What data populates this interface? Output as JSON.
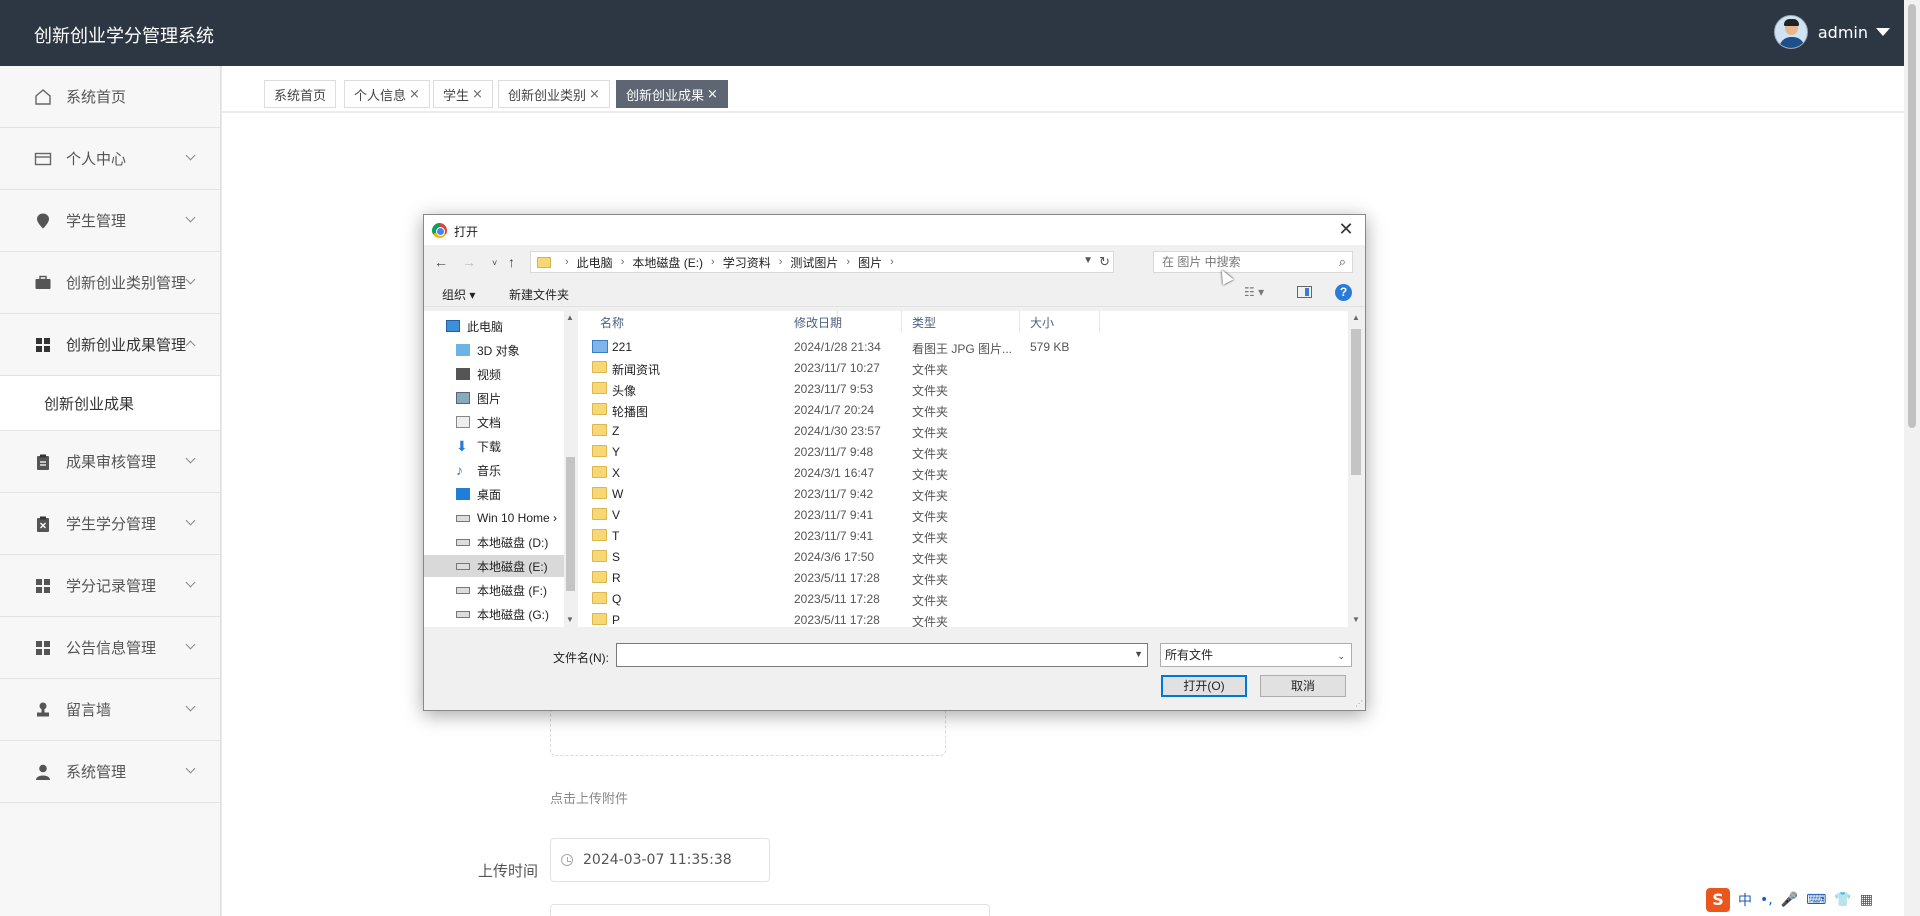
{
  "app": {
    "title": "创新创业学分管理系统",
    "user": "admin"
  },
  "sidebar": {
    "items": [
      {
        "label": "系统首页"
      },
      {
        "label": "个人中心"
      },
      {
        "label": "学生管理"
      },
      {
        "label": "创新创业类别管理"
      },
      {
        "label": "创新创业成果管理"
      },
      {
        "label": "创新创业成果"
      },
      {
        "label": "成果审核管理"
      },
      {
        "label": "学生学分管理"
      },
      {
        "label": "学分记录管理"
      },
      {
        "label": "公告信息管理"
      },
      {
        "label": "留言墙"
      },
      {
        "label": "系统管理"
      }
    ]
  },
  "tabs": [
    {
      "label": "系统首页",
      "closable": false
    },
    {
      "label": "个人信息",
      "closable": true
    },
    {
      "label": "学生",
      "closable": true
    },
    {
      "label": "创新创业类别",
      "closable": true
    },
    {
      "label": "创新创业成果",
      "closable": true,
      "active": true
    }
  ],
  "tab_close_glyph": "×",
  "form": {
    "upload_hint": "点击上传附件",
    "upload_time_label": "上传时间",
    "upload_time_value": "2024-03-07 11:35:38"
  },
  "dialog": {
    "title": "打开",
    "close_glyph": "✕",
    "breadcrumb": [
      "此电脑",
      "本地磁盘 (E:)",
      "学习资料",
      "测试图片",
      "图片"
    ],
    "search_placeholder": "在 图片 中搜索",
    "toolbar": {
      "organize": "组织 ▾",
      "new_folder": "新建文件夹",
      "help": "?"
    },
    "tree": [
      {
        "label": "此电脑",
        "icon": "computer-icon"
      },
      {
        "label": "3D 对象",
        "icon": "3d-objects-icon"
      },
      {
        "label": "视频",
        "icon": "video-icon"
      },
      {
        "label": "图片",
        "icon": "pictures-icon"
      },
      {
        "label": "文档",
        "icon": "documents-icon"
      },
      {
        "label": "下载",
        "icon": "download-icon"
      },
      {
        "label": "音乐",
        "icon": "music-icon"
      },
      {
        "label": "桌面",
        "icon": "desktop-icon"
      },
      {
        "label": "Win 10 Home ›",
        "icon": "drive-icon"
      },
      {
        "label": "本地磁盘 (D:)",
        "icon": "drive-icon"
      },
      {
        "label": "本地磁盘 (E:)",
        "icon": "drive-icon",
        "selected": true
      },
      {
        "label": "本地磁盘 (F:)",
        "icon": "drive-icon"
      },
      {
        "label": "本地磁盘 (G:)",
        "icon": "drive-icon"
      }
    ],
    "columns": {
      "name": "名称",
      "date": "修改日期",
      "type": "类型",
      "size": "大小"
    },
    "files": [
      {
        "name": "221",
        "date": "2024/1/28 21:34",
        "type": "看图王 JPG 图片...",
        "size": "579 KB",
        "kind": "image"
      },
      {
        "name": "新闻资讯",
        "date": "2023/11/7 10:27",
        "type": "文件夹",
        "size": "",
        "kind": "folder"
      },
      {
        "name": "头像",
        "date": "2023/11/7 9:53",
        "type": "文件夹",
        "size": "",
        "kind": "folder"
      },
      {
        "name": "轮播图",
        "date": "2024/1/7 20:24",
        "type": "文件夹",
        "size": "",
        "kind": "folder"
      },
      {
        "name": "Z",
        "date": "2024/1/30 23:57",
        "type": "文件夹",
        "size": "",
        "kind": "folder"
      },
      {
        "name": "Y",
        "date": "2023/11/7 9:48",
        "type": "文件夹",
        "size": "",
        "kind": "folder"
      },
      {
        "name": "X",
        "date": "2024/3/1 16:47",
        "type": "文件夹",
        "size": "",
        "kind": "folder"
      },
      {
        "name": "W",
        "date": "2023/11/7 9:42",
        "type": "文件夹",
        "size": "",
        "kind": "folder"
      },
      {
        "name": "V",
        "date": "2023/11/7 9:41",
        "type": "文件夹",
        "size": "",
        "kind": "folder"
      },
      {
        "name": "T",
        "date": "2023/11/7 9:41",
        "type": "文件夹",
        "size": "",
        "kind": "folder"
      },
      {
        "name": "S",
        "date": "2024/3/6 17:50",
        "type": "文件夹",
        "size": "",
        "kind": "folder"
      },
      {
        "name": "R",
        "date": "2023/5/11 17:28",
        "type": "文件夹",
        "size": "",
        "kind": "folder"
      },
      {
        "name": "Q",
        "date": "2023/5/11 17:28",
        "type": "文件夹",
        "size": "",
        "kind": "folder"
      },
      {
        "name": "P",
        "date": "2023/5/11 17:28",
        "type": "文件夹",
        "size": "",
        "kind": "folder"
      }
    ],
    "filename_label": "文件名(N):",
    "filename_value": "",
    "filetype_value": "所有文件",
    "open_button": "打开(O)",
    "cancel_button": "取消"
  },
  "ime": {
    "logo": "S",
    "mode": "中",
    "punct": "•,",
    "mic": "🎤",
    "keyboard": "⌨",
    "skin": "👕",
    "grid": "▦"
  }
}
